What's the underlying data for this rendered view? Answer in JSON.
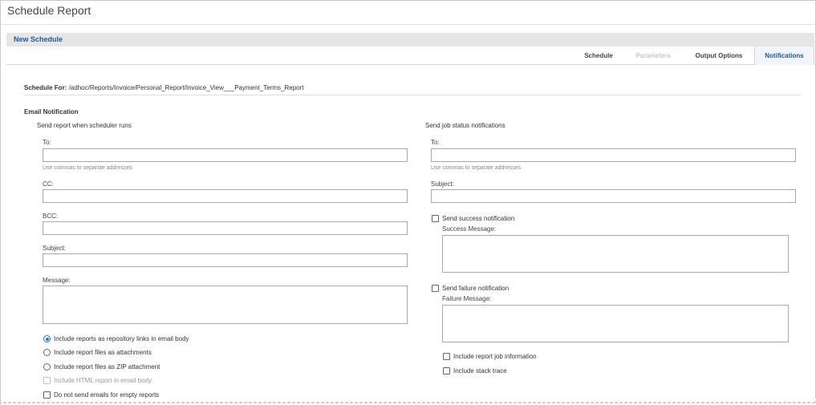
{
  "page": {
    "title": "Schedule Report",
    "subheader": "New Schedule"
  },
  "tabs": [
    {
      "label": "Schedule",
      "state": "enabled"
    },
    {
      "label": "Parameters",
      "state": "disabled"
    },
    {
      "label": "Output Options",
      "state": "enabled"
    },
    {
      "label": "Notifications",
      "state": "active"
    }
  ],
  "schedule_for": {
    "label": "Schedule For:",
    "path": "/adhoc/Reports/Invoice/Personal_Report/Invoice_View___Payment_Terms_Report"
  },
  "email_notification": {
    "section_title": "Email Notification",
    "left": {
      "heading": "Send report when scheduler runs",
      "to_label": "To:",
      "to_value": "",
      "to_hint": "Use commas to separate addresses",
      "cc_label": "CC:",
      "cc_value": "",
      "bcc_label": "BCC:",
      "bcc_value": "",
      "subject_label": "Subject:",
      "subject_value": "",
      "message_label": "Message:",
      "message_value": "",
      "options": [
        {
          "label": "Include reports as repository links in email body",
          "type": "radio",
          "checked": true
        },
        {
          "label": "Include report files as attachments",
          "type": "radio",
          "checked": false
        },
        {
          "label": "Include report files as ZIP attachment",
          "type": "radio",
          "checked": false
        },
        {
          "label": "Include HTML report in email body",
          "type": "checkbox",
          "checked": false,
          "disabled": true
        },
        {
          "label": "Do not send emails for empty reports",
          "type": "checkbox",
          "checked": false
        }
      ]
    },
    "right": {
      "heading": "Send job status notifications",
      "to_label": "To:",
      "to_value": "",
      "to_hint": "Use commas to separate addresses",
      "subject_label": "Subject:",
      "subject_value": "",
      "success_check_label": "Send success notification",
      "success_message_label": "Success Message:",
      "success_message_value": "",
      "failure_check_label": "Send failure notification",
      "failure_message_label": "Failure Message:",
      "failure_message_value": "",
      "include_job_info_label": "Include report job information",
      "include_stack_trace_label": "Include stack trace"
    }
  }
}
